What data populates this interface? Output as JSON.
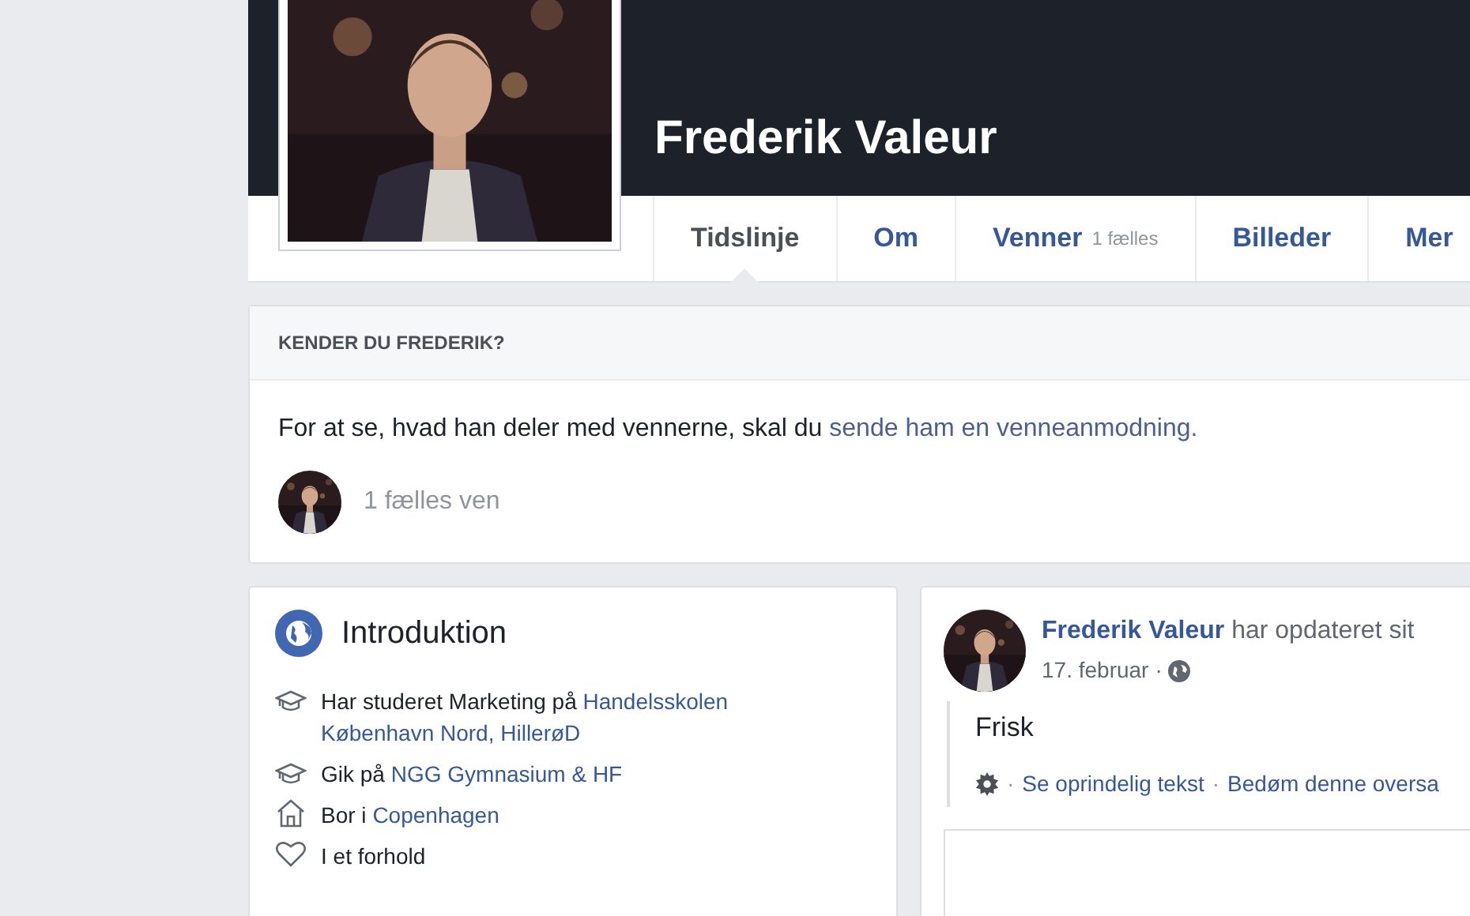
{
  "profile": {
    "name": "Frederik Valeur"
  },
  "tabs": [
    {
      "label": "Tidslinje",
      "selected": true
    },
    {
      "label": "Om",
      "selected": false
    },
    {
      "label": "Venner",
      "count": "1 fælles",
      "selected": false
    },
    {
      "label": "Billeder",
      "selected": false
    },
    {
      "label": "Mer",
      "selected": false
    }
  ],
  "know_card": {
    "title": "KENDER DU FREDERIK?",
    "text": "For at se, hvad han deler med vennerne, skal du",
    "link": "sende ham en venneanmodning.",
    "mutual": "1 fælles ven"
  },
  "intro": {
    "title": "Introduktion",
    "items": [
      {
        "kind": "education",
        "parts": [
          {
            "text": "Har studeret Marketing på ",
            "link": false
          },
          {
            "text": "Handelsskolen København Nord, HillerøD",
            "link": true
          }
        ]
      },
      {
        "kind": "education",
        "parts": [
          {
            "text": "Gik på ",
            "link": false
          },
          {
            "text": "NGG Gymnasium & HF",
            "link": true
          }
        ]
      },
      {
        "kind": "home",
        "parts": [
          {
            "text": "Bor i ",
            "link": false
          },
          {
            "text": "Copenhagen",
            "link": true
          }
        ]
      },
      {
        "kind": "relationship",
        "parts": [
          {
            "text": "I et forhold",
            "link": false
          }
        ]
      }
    ]
  },
  "post": {
    "author": "Frederik Valeur",
    "action": "har opdateret sit",
    "date": "17. februar",
    "separator": "·",
    "text": "Frisk",
    "links": [
      "Se oprindelig tekst",
      "Bedøm denne oversa"
    ]
  }
}
